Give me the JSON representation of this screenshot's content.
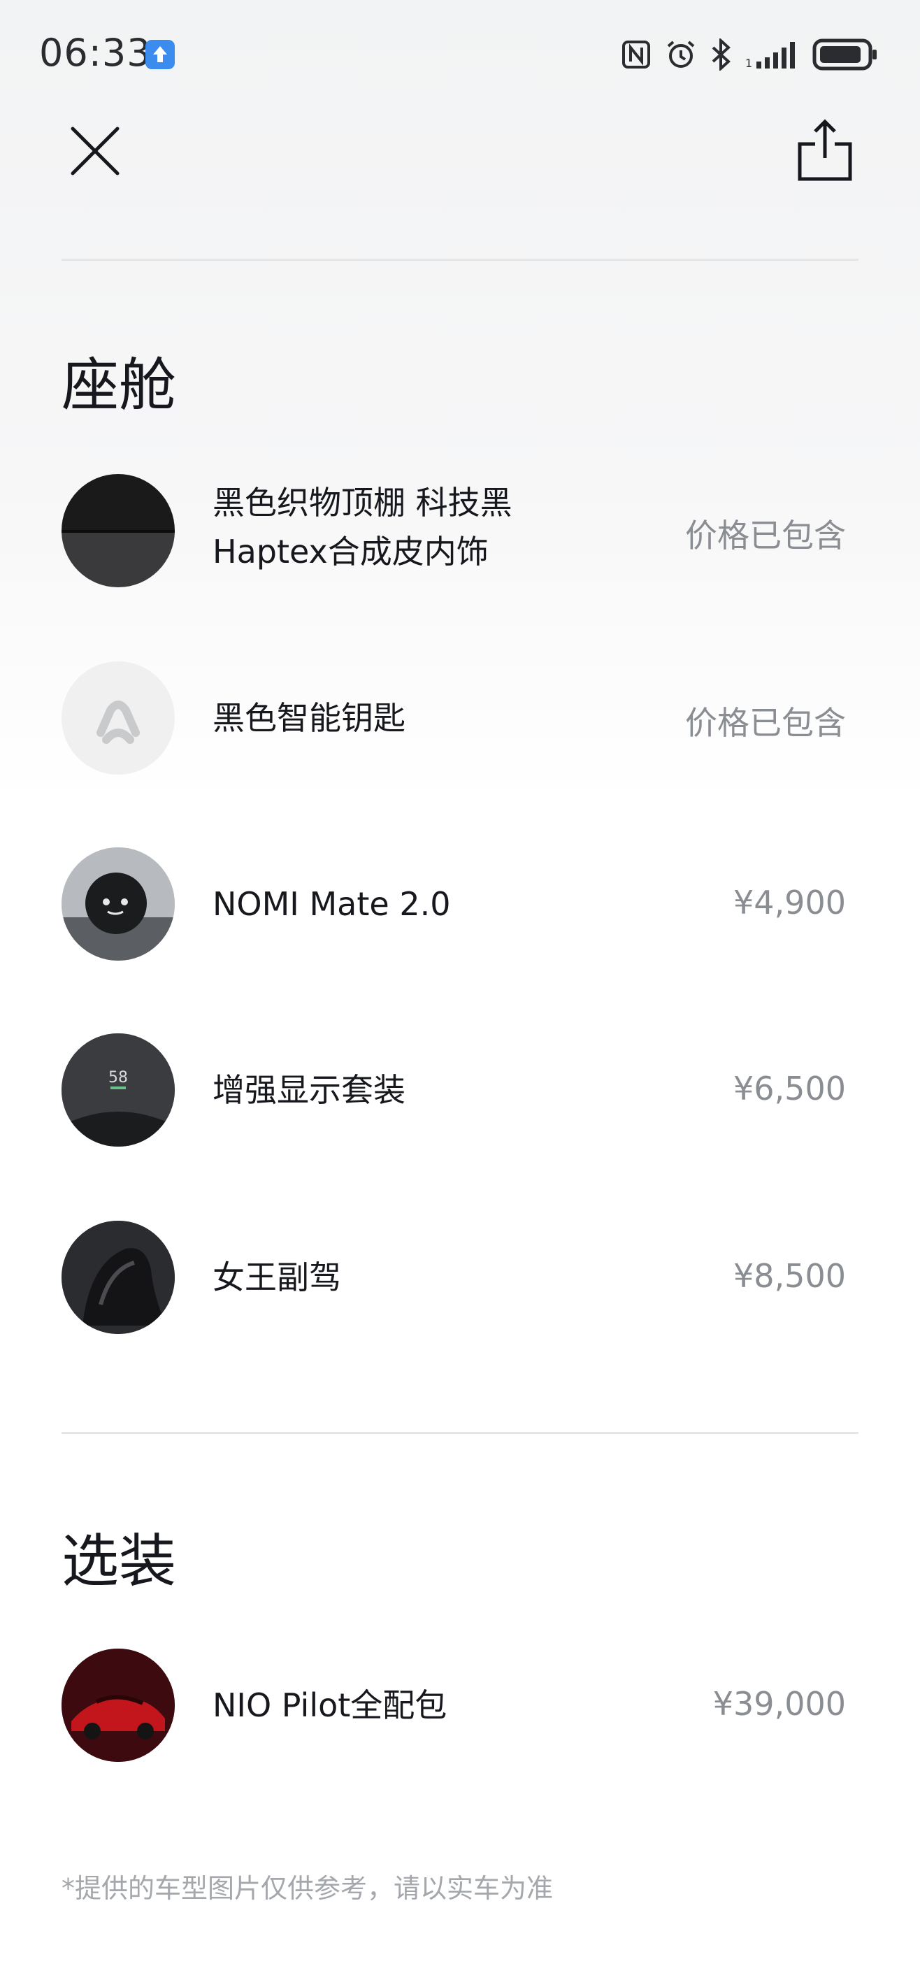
{
  "status_bar": {
    "time": "06:33",
    "icons": [
      "nfc-icon",
      "alarm-icon",
      "bluetooth-icon",
      "signal-icon",
      "battery-icon"
    ]
  },
  "nav": {
    "close_icon": "close-icon",
    "share_icon": "share-icon"
  },
  "cabin": {
    "title": "座舱",
    "items": [
      {
        "label_line1": "黑色织物顶棚 科技黑",
        "label_line2": "Haptex合成皮内饰",
        "price": "价格已包含"
      },
      {
        "label": "黑色智能钥匙",
        "price": "价格已包含"
      },
      {
        "label": "NOMI Mate 2.0",
        "price": "¥4,900"
      },
      {
        "label": "增强显示套装",
        "price": "¥6,500",
        "thumb_text": "58"
      },
      {
        "label": "女王副驾",
        "price": "¥8,500"
      }
    ]
  },
  "options": {
    "title": "选装",
    "items": [
      {
        "label": "NIO Pilot全配包",
        "price": "¥39,000"
      }
    ]
  },
  "footnote": "*提供的车型图片仅供参考，请以实车为准",
  "colors": {
    "text_primary": "#16181d",
    "text_secondary": "#8a8d92",
    "divider": "#e5e6e8",
    "badge_blue": "#3c8cf0"
  }
}
